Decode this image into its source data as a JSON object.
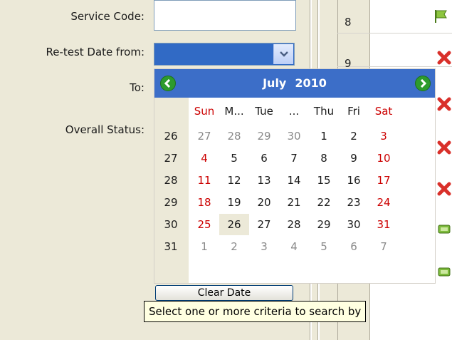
{
  "form": {
    "service_code_label": "Service Code:",
    "retest_from_label": "Re-test Date from:",
    "to_label": "To:",
    "overall_status_label": "Overall Status:"
  },
  "grid": {
    "row_numbers": [
      "8",
      "9"
    ]
  },
  "calendar": {
    "month": "July",
    "year": "2010",
    "day_names": [
      "Sun",
      "M...",
      "Tue",
      "...",
      "Thu",
      "Fri",
      "Sat"
    ],
    "week_numbers": [
      "26",
      "27",
      "28",
      "29",
      "30",
      "31"
    ],
    "weeks": [
      [
        "27",
        "28",
        "29",
        "30",
        "1",
        "2",
        "3"
      ],
      [
        "4",
        "5",
        "6",
        "7",
        "8",
        "9",
        "10"
      ],
      [
        "11",
        "12",
        "13",
        "14",
        "15",
        "16",
        "17"
      ],
      [
        "18",
        "19",
        "20",
        "21",
        "22",
        "23",
        "24"
      ],
      [
        "25",
        "26",
        "27",
        "28",
        "29",
        "30",
        "31"
      ],
      [
        "1",
        "2",
        "3",
        "4",
        "5",
        "6",
        "7"
      ]
    ],
    "clear_label": "Clear Date"
  },
  "tooltip": "Select one or more criteria to search by",
  "icons": {
    "nav_prev": "left-arrow-icon",
    "nav_next": "right-arrow-icon",
    "combo": "chevron-down-icon",
    "status": [
      "green-flag-icon",
      "red-x-icon",
      "red-x-icon",
      "red-x-icon",
      "red-x-icon",
      "green-gear-icon",
      "green-gear-icon"
    ]
  },
  "colors": {
    "header_blue": "#3c6ec8",
    "weekend_red": "#cc0000",
    "selection_blue": "#316ac5"
  }
}
